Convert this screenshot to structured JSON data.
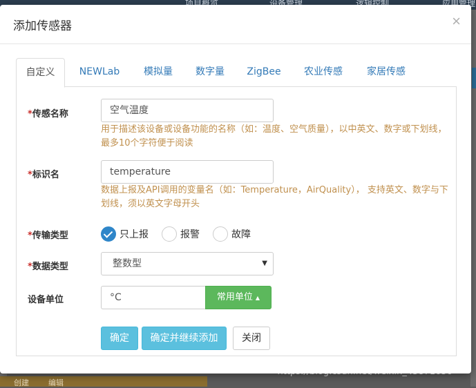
{
  "background": {
    "nav_items": [
      "项目概览",
      "设备管理",
      "逻辑控制",
      "应用管理"
    ],
    "bottom_items": [
      "创建",
      "编辑"
    ],
    "watermark": "https://blog.csdn.net/weixin_43871650"
  },
  "modal": {
    "title": "添加传感器",
    "close": "×"
  },
  "tabs": [
    {
      "label": "自定义",
      "active": true
    },
    {
      "label": "NEWLab",
      "active": false
    },
    {
      "label": "模拟量",
      "active": false
    },
    {
      "label": "数字量",
      "active": false
    },
    {
      "label": "ZigBee",
      "active": false
    },
    {
      "label": "农业传感",
      "active": false
    },
    {
      "label": "家居传感",
      "active": false
    }
  ],
  "form": {
    "required_mark": "*",
    "sensor_name": {
      "label": "传感名称",
      "value": "空气温度",
      "help": "用于描述该设备或设备功能的名称（如：温度、空气质量），以中英文、数字或下划线，最多10个字符便于阅读"
    },
    "identifier": {
      "label": "标识名",
      "value": "temperature",
      "help": "数据上报及API调用的变量名（如：Temperature，AirQuality）， 支持英文、数字与下划线，须以英文字母开头"
    },
    "transfer_type": {
      "label": "传输类型",
      "options": [
        {
          "label": "只上报",
          "checked": true
        },
        {
          "label": "报警",
          "checked": false
        },
        {
          "label": "故障",
          "checked": false
        }
      ]
    },
    "data_type": {
      "label": "数据类型",
      "value": "整数型",
      "caret": "▼"
    },
    "unit": {
      "label": "设备单位",
      "value": "°C",
      "button_label": "常用单位",
      "button_caret": "▲"
    }
  },
  "buttons": {
    "confirm": "确定",
    "confirm_continue": "确定并继续添加",
    "close": "关闭"
  }
}
